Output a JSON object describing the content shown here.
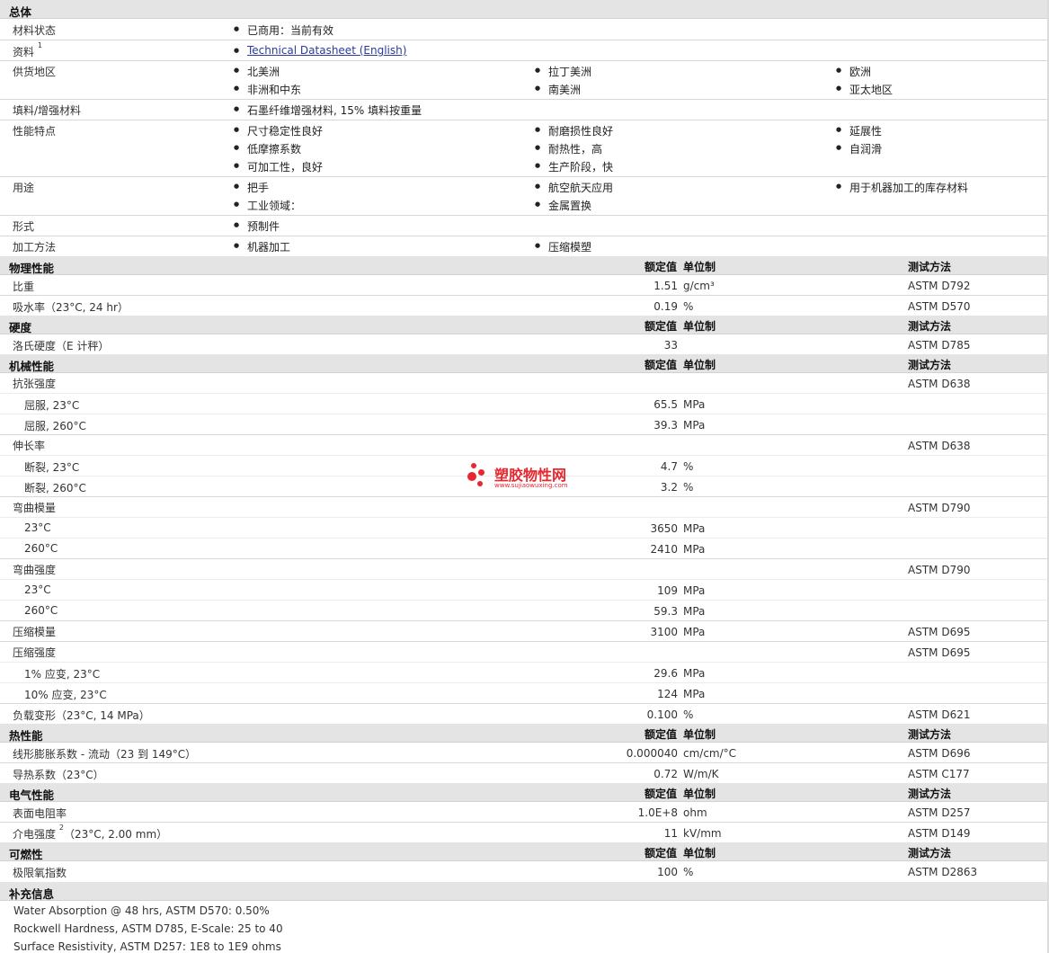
{
  "general": {
    "title": "总体",
    "status_label": "材料状态",
    "status_value": "已商用：当前有效",
    "docs_label": "资料",
    "docs_sup": "1",
    "docs_link": "Technical Datasheet (English)",
    "regions_label": "供货地区",
    "regions": [
      "北美洲",
      "拉丁美洲",
      "欧洲",
      "非洲和中东",
      "南美洲",
      "亚太地区"
    ],
    "filler_label": "填料/增强材料",
    "filler_value": "石墨纤维增强材料, 15% 填料按重量",
    "features_label": "性能特点",
    "features": [
      "尺寸稳定性良好",
      "耐磨损性良好",
      "延展性",
      "低摩擦系数",
      "耐热性，高",
      "自润滑",
      "可加工性，良好",
      "生产阶段，快"
    ],
    "uses_label": "用途",
    "uses": [
      "把手",
      "航空航天应用",
      "用于机器加工的库存材料",
      "工业领域：",
      "金属置换"
    ],
    "form_label": "形式",
    "form_value": "预制件",
    "process_label": "加工方法",
    "process": [
      "机器加工",
      "压缩模塑"
    ]
  },
  "columns": {
    "value": "额定值",
    "unit": "单位制",
    "method": "测试方法"
  },
  "physical": {
    "title": "物理性能",
    "rows": [
      {
        "label": "比重",
        "value": "1.51",
        "unit": "g/cm³",
        "method": "ASTM D792"
      },
      {
        "label": "吸水率（23°C, 24 hr）",
        "value": "0.19",
        "unit": "%",
        "method": "ASTM D570"
      }
    ]
  },
  "hardness": {
    "title": "硬度",
    "rows": [
      {
        "label": "洛氏硬度（E 计秤）",
        "value": "33",
        "unit": "",
        "method": "ASTM D785"
      }
    ]
  },
  "mechanical": {
    "title": "机械性能",
    "tensile": {
      "label": "抗张强度",
      "method": "ASTM D638",
      "sub": [
        {
          "label": "屈服, 23°C",
          "value": "65.5",
          "unit": "MPa"
        },
        {
          "label": "屈服, 260°C",
          "value": "39.3",
          "unit": "MPa"
        }
      ]
    },
    "elong": {
      "label": "伸长率",
      "method": "ASTM D638",
      "sub": [
        {
          "label": "断裂, 23°C",
          "value": "4.7",
          "unit": "%"
        },
        {
          "label": "断裂, 260°C",
          "value": "3.2",
          "unit": "%"
        }
      ]
    },
    "flexmod": {
      "label": "弯曲模量",
      "method": "ASTM D790",
      "sub": [
        {
          "label": "23°C",
          "value": "3650",
          "unit": "MPa"
        },
        {
          "label": "260°C",
          "value": "2410",
          "unit": "MPa"
        }
      ]
    },
    "flexstr": {
      "label": "弯曲强度",
      "method": "ASTM D790",
      "sub": [
        {
          "label": "23°C",
          "value": "109",
          "unit": "MPa"
        },
        {
          "label": "260°C",
          "value": "59.3",
          "unit": "MPa"
        }
      ]
    },
    "compmod": {
      "label": "压缩模量",
      "value": "3100",
      "unit": "MPa",
      "method": "ASTM D695"
    },
    "compstr": {
      "label": "压缩强度",
      "method": "ASTM D695",
      "sub": [
        {
          "label": "1% 应变, 23°C",
          "value": "29.6",
          "unit": "MPa"
        },
        {
          "label": "10% 应变, 23°C",
          "value": "124",
          "unit": "MPa"
        }
      ]
    },
    "deform": {
      "label": "负载变形（23°C, 14 MPa）",
      "value": "0.100",
      "unit": "%",
      "method": "ASTM D621"
    }
  },
  "thermal": {
    "title": "热性能",
    "rows": [
      {
        "label": "线形膨胀系数 - 流动（23 到 149°C）",
        "value": "0.000040",
        "unit": "cm/cm/°C",
        "method": "ASTM D696"
      },
      {
        "label": "导热系数（23°C）",
        "value": "0.72",
        "unit": "W/m/K",
        "method": "ASTM C177"
      }
    ]
  },
  "electrical": {
    "title": "电气性能",
    "rows": [
      {
        "label": "表面电阻率",
        "value": "1.0E+8",
        "unit": "ohm",
        "method": "ASTM D257"
      },
      {
        "label": "介电强度",
        "sup": "2",
        "label2": "（23°C, 2.00 mm）",
        "value": "11",
        "unit": "kV/mm",
        "method": "ASTM D149"
      }
    ]
  },
  "flammability": {
    "title": "可燃性",
    "rows": [
      {
        "label": "极限氧指数",
        "value": "100",
        "unit": "%",
        "method": "ASTM D2863"
      }
    ]
  },
  "supplement": {
    "title": "补充信息",
    "notes": [
      "Water Absorption @ 48 hrs, ASTM D570: 0.50%",
      "Rockwell Hardness, ASTM D785, E-Scale: 25 to 40",
      "Surface Resistivity, ASTM D257: 1E8 to 1E9 ohms"
    ]
  },
  "watermark": {
    "text": "塑胶物性网",
    "url": "www.sujiaowuxing.com",
    "color": "#e8262e"
  }
}
